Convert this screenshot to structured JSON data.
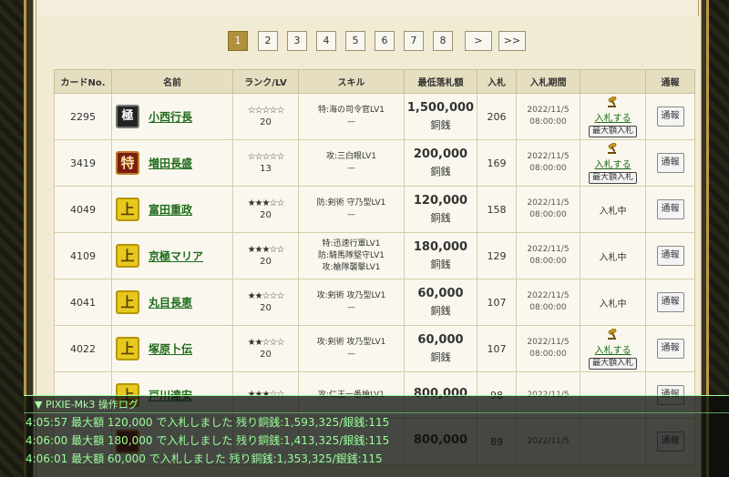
{
  "pagination": {
    "pages": [
      "1",
      "2",
      "3",
      "4",
      "5",
      "6",
      "7",
      "8"
    ],
    "active": "1",
    "next": ">",
    "last": ">>"
  },
  "table": {
    "headers": {
      "no": "カードNo.",
      "name": "名前",
      "rank": "ランク/LV",
      "skill": "スキル",
      "price": "最低落札額",
      "bids": "入札",
      "period": "入札期間",
      "action": "",
      "report": "通報"
    },
    "rows": [
      {
        "no": "2295",
        "icon": "極",
        "icon_type": "kyoku",
        "name": "小西行長",
        "stars": "☆☆☆☆☆",
        "lv": "20",
        "skill1": "特:海の司令官LV1",
        "skill2": "—",
        "skill3": "",
        "price": "1,500,000",
        "unit": "銅銭",
        "bids": "206",
        "date": "2022/11/5",
        "time": "08:00:00",
        "bid_label": "入札する",
        "max_label": "最大額入札",
        "status": "",
        "report": "通報"
      },
      {
        "no": "3419",
        "icon": "特",
        "icon_type": "toku",
        "name": "増田長盛",
        "stars": "☆☆☆☆☆",
        "lv": "13",
        "skill1": "攻:三白眼LV1",
        "skill2": "—",
        "skill3": "",
        "price": "200,000",
        "unit": "銅銭",
        "bids": "169",
        "date": "2022/11/5",
        "time": "08:00:00",
        "bid_label": "入札する",
        "max_label": "最大額入札",
        "status": "",
        "report": "通報"
      },
      {
        "no": "4049",
        "icon": "上",
        "icon_type": "jou",
        "name": "富田重政",
        "stars": "★★★☆☆",
        "lv": "20",
        "skill1": "防:剣術 守乃型LV1",
        "skill2": "—",
        "skill3": "",
        "price": "120,000",
        "unit": "銅銭",
        "bids": "158",
        "date": "2022/11/5",
        "time": "08:00:00",
        "bid_label": "",
        "max_label": "",
        "status": "入札中",
        "report": "通報"
      },
      {
        "no": "4109",
        "icon": "上",
        "icon_type": "jou",
        "name": "京極マリア",
        "stars": "★★★☆☆",
        "lv": "20",
        "skill1": "特:迅速行軍LV1",
        "skill2": "防:騎馬隊堅守LV1",
        "skill3": "攻:槍隊襲撃LV1",
        "price": "180,000",
        "unit": "銅銭",
        "bids": "129",
        "date": "2022/11/5",
        "time": "08:00:00",
        "bid_label": "",
        "max_label": "",
        "status": "入札中",
        "report": "通報"
      },
      {
        "no": "4041",
        "icon": "上",
        "icon_type": "jou",
        "name": "丸目長恵",
        "stars": "★★☆☆☆",
        "lv": "20",
        "skill1": "攻:剣術 攻乃型LV1",
        "skill2": "—",
        "skill3": "",
        "price": "60,000",
        "unit": "銅銭",
        "bids": "107",
        "date": "2022/11/5",
        "time": "08:00:00",
        "bid_label": "",
        "max_label": "",
        "status": "入札中",
        "report": "通報"
      },
      {
        "no": "4022",
        "icon": "上",
        "icon_type": "jou",
        "name": "塚原卜伝",
        "stars": "★★☆☆☆",
        "lv": "20",
        "skill1": "攻:剣術 攻乃型LV1",
        "skill2": "—",
        "skill3": "",
        "price": "60,000",
        "unit": "銅銭",
        "bids": "107",
        "date": "2022/11/5",
        "time": "08:00:00",
        "bid_label": "入札する",
        "max_label": "最大額入札",
        "status": "",
        "report": "通報"
      },
      {
        "no": "",
        "icon": "上",
        "icon_type": "jou",
        "name": "戸川達安",
        "stars": "★★★☆☆",
        "lv": "",
        "skill1": "攻:仁王一番槍LV1",
        "skill2": "",
        "skill3": "",
        "price": "800,000",
        "unit": "",
        "bids": "98",
        "date": "2022/11/5",
        "time": "",
        "bid_label": "",
        "max_label": "",
        "status": "",
        "report": "通報"
      },
      {
        "no": "",
        "icon": "",
        "icon_type": "toku",
        "name": "",
        "stars": "",
        "lv": "",
        "skill1": "",
        "skill2": "",
        "skill3": "",
        "price": "800,000",
        "unit": "",
        "bids": "89",
        "date": "2022/11/5",
        "time": "",
        "bid_label": "",
        "max_label": "",
        "status": "",
        "report": "通報"
      }
    ]
  },
  "log": {
    "title": "▼ PIXIE-Mk3 操作ログ",
    "lines": [
      "4:05:57 最大額 120,000 で入札しました 残り銅銭:1,593,325/銀銭:115",
      "4:06:00 最大額 180,000 で入札しました 残り銅銭:1,413,325/銀銭:115",
      "4:06:01 最大額 60,000 で入札しました 残り銅銭:1,353,325/銀銭:115"
    ]
  },
  "colors": {
    "gold": "#b0903c",
    "link_green": "#1f6a1c",
    "log_green": "#99ff99"
  }
}
